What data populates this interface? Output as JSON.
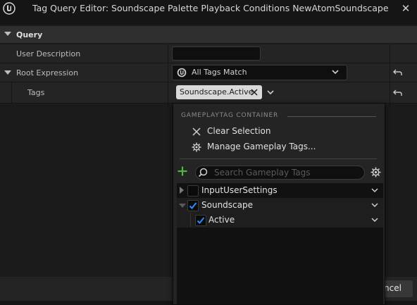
{
  "window": {
    "title": "Tag Query Editor: Soundscape Palette Playback Conditions NewAtomSoundscapePalette",
    "close_icon": "close-icon"
  },
  "query": {
    "section_label": "Query",
    "user_description_label": "User Description",
    "user_description_value": "",
    "root_expression_label": "Root Expression",
    "root_expression_value": "All Tags Match",
    "tags_label": "Tags",
    "tag_chip": "Soundscape.Active"
  },
  "dropdown": {
    "heading": "GAMEPLAYTAG CONTAINER",
    "clear_selection": "Clear Selection",
    "manage_tags": "Manage Gameplay Tags...",
    "search_placeholder": "Search Gameplay Tags",
    "tree": [
      {
        "label": "InputUserSettings",
        "checked": false,
        "expanded": false,
        "depth": 0
      },
      {
        "label": "Soundscape",
        "checked": true,
        "expanded": true,
        "depth": 0
      },
      {
        "label": "Active",
        "checked": true,
        "expanded": false,
        "depth": 1
      }
    ]
  },
  "footer": {
    "cancel_visible": "ncel"
  },
  "colors": {
    "accent_check": "#2a8cff",
    "add_green": "#4cbb3a",
    "panel_bg": "#242424"
  }
}
